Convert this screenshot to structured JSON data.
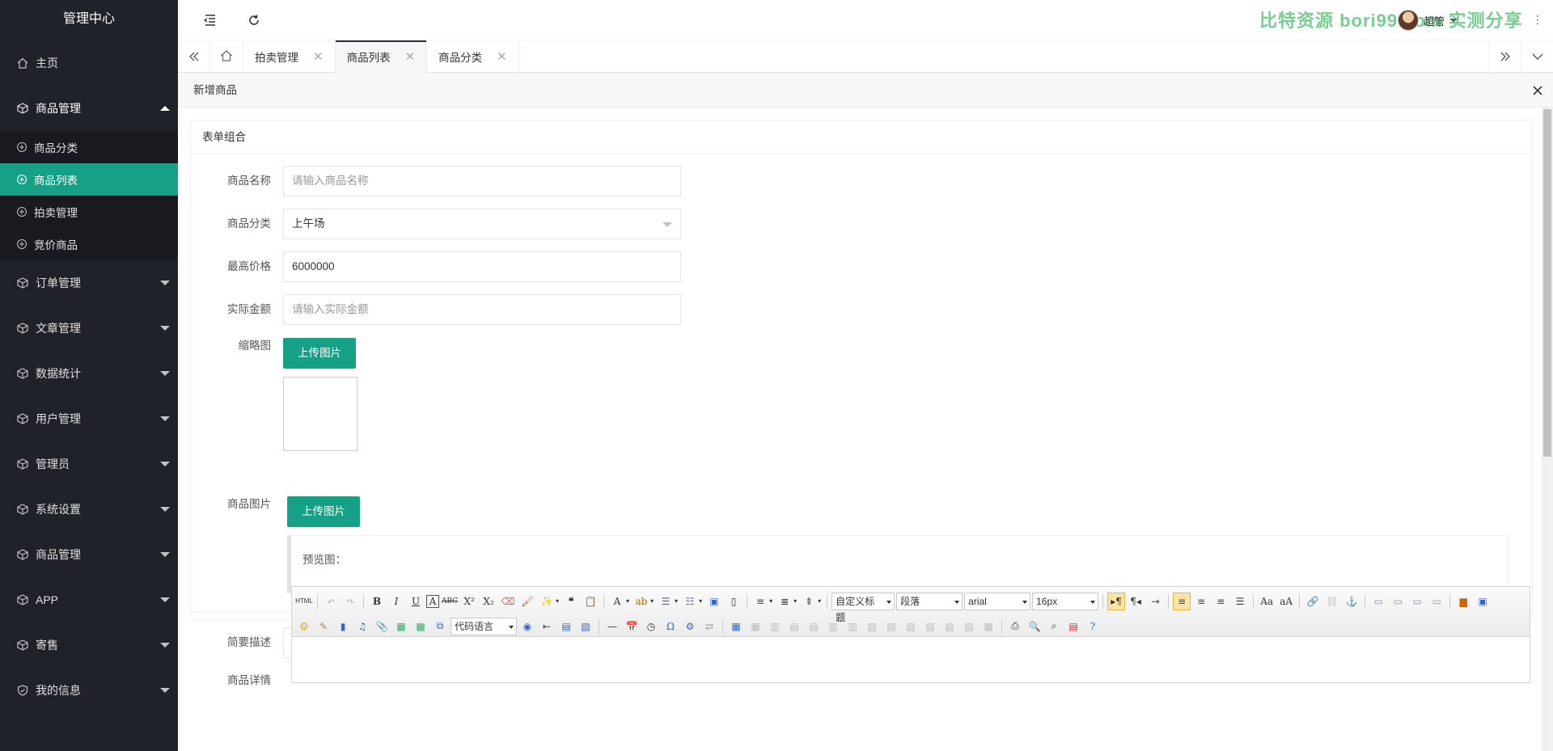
{
  "app": {
    "title": "管理中心"
  },
  "sidebar": {
    "home": "主页",
    "group_goods": "商品管理",
    "sub_items": [
      "商品分类",
      "商品列表",
      "拍卖管理",
      "竞价商品"
    ],
    "groups": [
      "订单管理",
      "文章管理",
      "数据统计",
      "用户管理",
      "管理员",
      "系统设置",
      "商品管理",
      "APP",
      "寄售",
      "我的信息"
    ]
  },
  "header": {
    "watermark": "比特资源 bori99.com 实测分享",
    "user_name": "超管",
    "more": "⋮"
  },
  "tabs": [
    {
      "label": "拍卖管理"
    },
    {
      "label": "商品列表"
    },
    {
      "label": "商品分类"
    }
  ],
  "dialog": {
    "title": "新增商品",
    "card_title": "表单组合",
    "form": {
      "name_label": "商品名称",
      "name_placeholder": "请输入商品名称",
      "category_label": "商品分类",
      "category_value": "上午场",
      "max_price_label": "最高价格",
      "max_price_value": "6000000",
      "actual_label": "实际金额",
      "actual_placeholder": "请输入实际金额",
      "thumb_label": "缩略图",
      "upload_label": "上传图片",
      "images_label": "商品图片",
      "upload_label2": "上传图片",
      "preview_label": "预览图：",
      "desc_label": "简要描述",
      "detail_label": "商品详情"
    },
    "editor": {
      "custom_heading": "自定义标题",
      "paragraph": "段落",
      "font_family": "arial",
      "font_size": "16px",
      "code_language": "代码语言"
    }
  }
}
